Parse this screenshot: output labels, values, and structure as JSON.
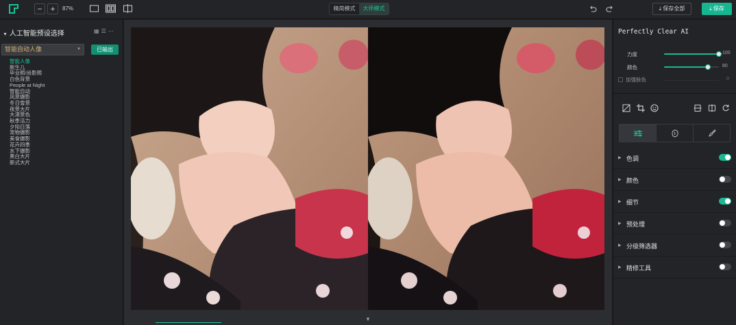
{
  "toolbar": {
    "zoom_out": "−",
    "zoom_in": "+",
    "zoom_level": "87%",
    "mode_simple": "精简模式",
    "mode_master": "大师模式",
    "save_all": "保存全部",
    "save": "保存",
    "accent": "#16b691"
  },
  "left": {
    "title": "人工智能预设选择",
    "select_value": "智能自动人像",
    "export_label": "已输出",
    "presets": [
      "智能人像",
      "新生儿",
      "毕业照/尚影照",
      "白色背景",
      "People at Night",
      "智能自动",
      "风景摄影",
      "冬日雪景",
      "夜景大片",
      "大漠景色",
      "秋季活力",
      "夕阳日落",
      "宠物摄影",
      "美食摄影",
      "花卉四季",
      "水下摄影",
      "黑白大片",
      "新式大片"
    ]
  },
  "right": {
    "title": "Perfectly Clear AI",
    "sliders": [
      {
        "label": "力度",
        "value": "100",
        "fraction": 1.0
      },
      {
        "label": "颜色",
        "value": "80",
        "fraction": 0.8
      }
    ],
    "checkbox_label": "加强肤色",
    "checkbox_value": "0",
    "sections": [
      {
        "label": "色调",
        "on": true
      },
      {
        "label": "颜色",
        "on": false
      },
      {
        "label": "细节",
        "on": true
      },
      {
        "label": "预处理",
        "on": false
      },
      {
        "label": "分级筛选器",
        "on": false
      },
      {
        "label": "精修工具",
        "on": false
      }
    ]
  }
}
